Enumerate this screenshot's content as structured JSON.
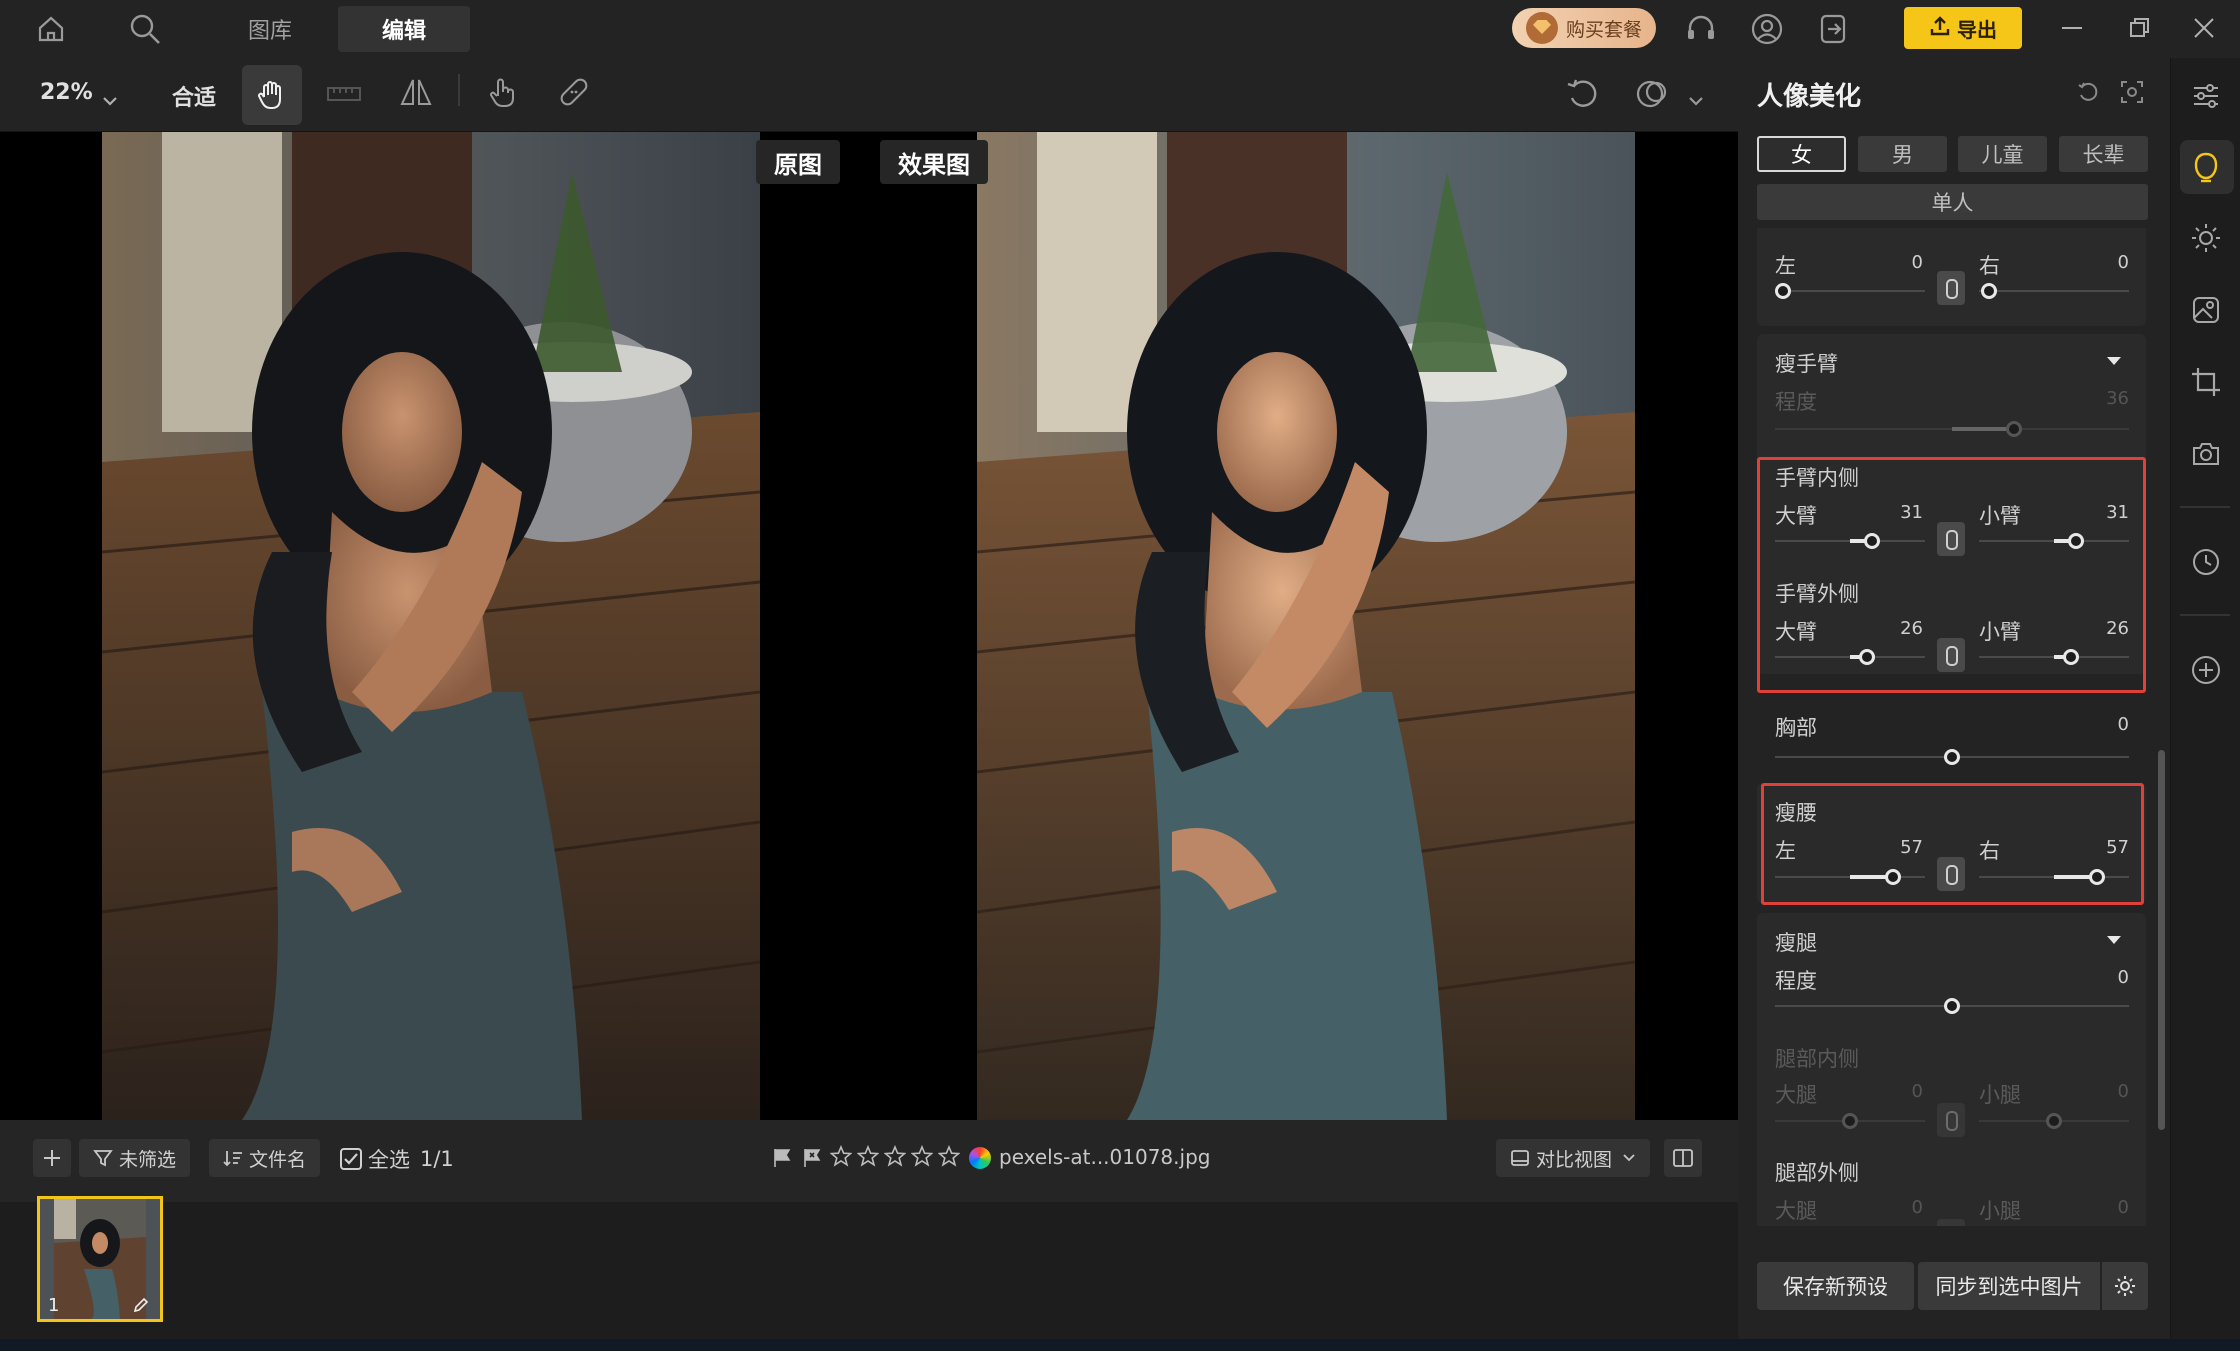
{
  "nav": {
    "tab_library": "图库",
    "tab_edit": "编辑",
    "buy_label": "购买套餐",
    "export_label": "导出"
  },
  "toolbar": {
    "zoom": "22%",
    "fit_label": "合适"
  },
  "compare": {
    "before_label": "原图",
    "after_label": "效果图"
  },
  "filmbar": {
    "filter_label": "未筛选",
    "sort_label": "文件名",
    "select_all_label": "全选",
    "count": "1/1",
    "filename": "pexels-at...01078.jpg",
    "view_label": "对比视图",
    "rating_stars": 5
  },
  "thumbnail": {
    "index": "1"
  },
  "panel": {
    "title": "人像美化",
    "gender_tabs": [
      "女",
      "男",
      "儿童",
      "长辈"
    ],
    "single_label": "单人",
    "shoulder": {
      "left_label": "左",
      "left_value": "0",
      "right_label": "右",
      "right_value": "0"
    },
    "thin_arm": {
      "title": "瘦手臂",
      "degree_label": "程度",
      "degree_value": "36"
    },
    "inner_arm": {
      "title": "手臂内侧",
      "upper_label": "大臂",
      "upper_value": "31",
      "fore_label": "小臂",
      "fore_value": "31"
    },
    "outer_arm": {
      "title": "手臂外侧",
      "upper_label": "大臂",
      "upper_value": "26",
      "fore_label": "小臂",
      "fore_value": "26"
    },
    "chest": {
      "title": "胸部",
      "value": "0"
    },
    "waist": {
      "title": "瘦腰",
      "left_label": "左",
      "left_value": "57",
      "right_label": "右",
      "right_value": "57"
    },
    "legs": {
      "title": "瘦腿",
      "degree_label": "程度",
      "degree_value": "0"
    },
    "inner_leg": {
      "title": "腿部内侧",
      "thigh_label": "大腿",
      "thigh_value": "0",
      "calf_label": "小腿",
      "calf_value": "0"
    },
    "outer_leg": {
      "title": "腿部外侧",
      "thigh_label": "大腿",
      "thigh_value": "0",
      "calf_label": "小腿",
      "calf_value": "0"
    },
    "save_preset_label": "保存新预设",
    "sync_label": "同步到选中图片"
  },
  "colors": {
    "accent": "#f5c518",
    "highlight_box": "#e0403a",
    "panel_bg": "#232323"
  }
}
